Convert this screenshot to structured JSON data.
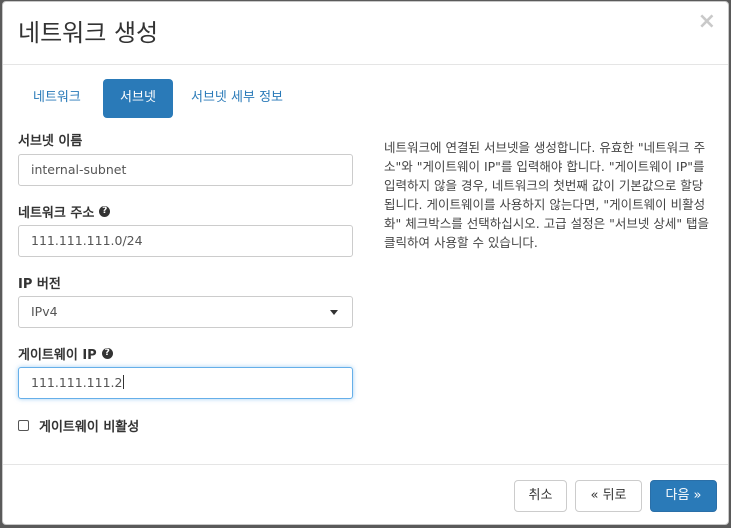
{
  "dialog": {
    "title": "네트워크 생성",
    "close_glyph": "×"
  },
  "tabs": [
    {
      "label": "네트워크",
      "active": false
    },
    {
      "label": "서브넷",
      "active": true
    },
    {
      "label": "서브넷 세부 정보",
      "active": false
    }
  ],
  "form": {
    "subnet_name": {
      "label": "서브넷 이름",
      "value": "internal-subnet"
    },
    "network_address": {
      "label": "네트워크 주소",
      "value": "111.111.111.0/24",
      "help_icon": "?"
    },
    "ip_version": {
      "label": "IP 버전",
      "selected": "IPv4"
    },
    "gateway_ip": {
      "label": "게이트웨이 IP",
      "value": "111.111.111.2",
      "help_icon": "?"
    },
    "disable_gateway": {
      "label": "게이트웨이 비활성",
      "checked": false
    }
  },
  "help_text": "네트워크에 연결된 서브넷을 생성합니다. 유효한 \"네트워크 주소\"와 \"게이트웨이 IP\"를 입력해야 합니다. \"게이트웨이 IP\"를 입력하지 않을 경우, 네트워크의 첫번째 값이 기본값으로 할당됩니다. 게이트웨이를 사용하지 않는다면, \"게이트웨이 비활성화\" 체크박스를 선택하십시오. 고급 설정은 \"서브넷 상세\" 탭을 클릭하여 사용할 수 있습니다.",
  "footer": {
    "cancel_label": "취소",
    "back_label": "« 뒤로",
    "next_label": "다음 »"
  },
  "colors": {
    "accent": "#2a7ab8"
  }
}
